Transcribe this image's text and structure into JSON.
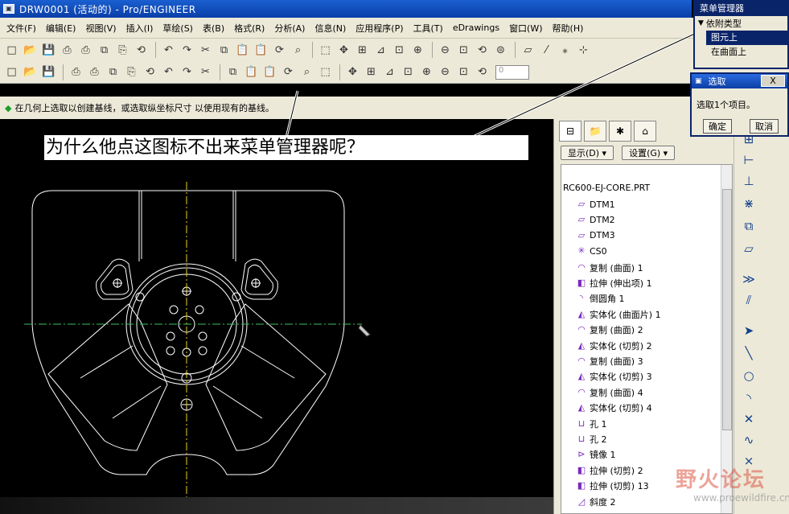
{
  "window": {
    "title": "DRW0001 (活动的) - Pro/ENGINEER"
  },
  "menubar": [
    "文件(F)",
    "编辑(E)",
    "视图(V)",
    "插入(I)",
    "草绘(S)",
    "表(B)",
    "格式(R)",
    "分析(A)",
    "信息(N)",
    "应用程序(P)",
    "工具(T)",
    "eDrawings",
    "窗口(W)",
    "帮助(H)"
  ],
  "toolbar1": [
    "new-icon",
    "open-icon",
    "save-icon",
    "print-preview-icon",
    "print-icon",
    "copy-drawing-icon",
    "snapshot-icon",
    "repaint-icon",
    "undo-icon",
    "redo-icon",
    "cut-icon",
    "copy-icon",
    "paste-icon",
    "paste-special-icon",
    "regen-icon",
    "find-icon",
    "select-box-icon",
    "spin-center-icon",
    "datum-icon",
    "measure-icon",
    "model-icon",
    "zoom-in-icon",
    "zoom-out-icon",
    "refit-icon",
    "reorient-icon",
    "layer-icon",
    "plane-icon",
    "axis-icon",
    "point-icon",
    "csys-icon"
  ],
  "toolbar2": [
    "show-icon",
    "hide-icon",
    "erase-icon",
    "delete-icon",
    "align-icon",
    "flip-icon",
    "move-icon",
    "swap-icon",
    "table-icon",
    "grid-icon",
    "line-icon",
    "clip-icon",
    "edit-icon",
    "ordinate-icon",
    "text-icon",
    "note-icon",
    "gtol-icon",
    "surface-finish-icon",
    "balloon-icon",
    "symbol-icon",
    "hatch-icon",
    "format-icon",
    "table-insert-icon",
    "repeat-icon",
    "property-icon"
  ],
  "toolbar2_input": "0",
  "message": "在几何上选取以创建基线，或选取纵坐标尺寸 以使用现有的基线。",
  "question_text": "为什么他点这图标不出来菜单管理器呢？",
  "model_tree": {
    "display_button": "显示(D) ▾",
    "settings_button": "设置(G) ▾",
    "root": "RC600-EJ-CORE.PRT",
    "items": [
      {
        "icon": "datum-plane-icon",
        "glyph": "▱",
        "label": "DTM1"
      },
      {
        "icon": "datum-plane-icon",
        "glyph": "▱",
        "label": "DTM2"
      },
      {
        "icon": "datum-plane-icon",
        "glyph": "▱",
        "label": "DTM3"
      },
      {
        "icon": "csys-icon",
        "glyph": "✳",
        "label": "CS0"
      },
      {
        "icon": "copy-surface-icon",
        "glyph": "◠",
        "label": "复制 (曲面) 1"
      },
      {
        "icon": "extrude-icon",
        "glyph": "◧",
        "label": "拉伸 (伸出项) 1"
      },
      {
        "icon": "round-icon",
        "glyph": "◝",
        "label": "倒圆角 1"
      },
      {
        "icon": "solidify-icon",
        "glyph": "◭",
        "label": "实体化 (曲面片) 1"
      },
      {
        "icon": "copy-surface-icon",
        "glyph": "◠",
        "label": "复制 (曲面) 2"
      },
      {
        "icon": "solidify-icon",
        "glyph": "◭",
        "label": "实体化 (切剪) 2"
      },
      {
        "icon": "copy-surface-icon",
        "glyph": "◠",
        "label": "复制 (曲面) 3"
      },
      {
        "icon": "solidify-icon",
        "glyph": "◭",
        "label": "实体化 (切剪) 3"
      },
      {
        "icon": "copy-surface-icon",
        "glyph": "◠",
        "label": "复制 (曲面) 4"
      },
      {
        "icon": "solidify-icon",
        "glyph": "◭",
        "label": "实体化 (切剪) 4"
      },
      {
        "icon": "hole-icon",
        "glyph": "⊔",
        "label": "孔 1"
      },
      {
        "icon": "hole-icon",
        "glyph": "⊔",
        "label": "孔 2"
      },
      {
        "icon": "mirror-icon",
        "glyph": "⊳",
        "label": "镜像 1"
      },
      {
        "icon": "extrude-icon",
        "glyph": "◧",
        "label": "拉伸 (切剪) 2"
      },
      {
        "icon": "extrude-icon",
        "glyph": "◧",
        "label": "拉伸 (切剪) 13"
      },
      {
        "icon": "draft-icon",
        "glyph": "◿",
        "label": "斜度 2"
      }
    ]
  },
  "vtoolbar": [
    "select-arrow-icon",
    "line-icon",
    "circle-icon",
    "arc-icon",
    "point-icon",
    "spline-icon"
  ],
  "menu_manager": {
    "title": "菜单管理器",
    "header": "依附类型",
    "items": [
      "图元上",
      "在曲面上"
    ],
    "selected": 0
  },
  "select_dialog": {
    "title": "选取",
    "close_label": "X",
    "text": "选取1个项目。",
    "ok_label": "确定",
    "cancel_label": "取消"
  },
  "watermark": {
    "text": "野火论坛",
    "url": "www.proewildfire.cn"
  },
  "colors": {
    "drawing_line": "#ffffff",
    "centerline_yellow": "#e8d020",
    "centerline_green": "#3cc060",
    "accent": "#0a246a"
  }
}
